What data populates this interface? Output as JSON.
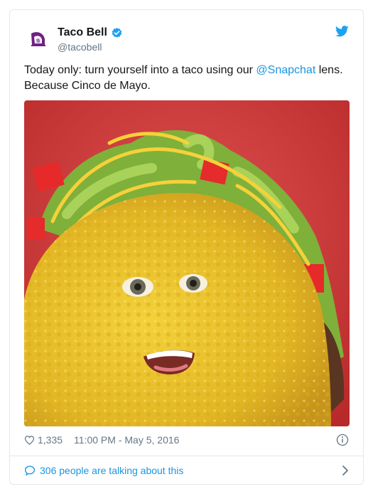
{
  "author": {
    "display_name": "Taco Bell",
    "handle": "@tacobell",
    "verified": true
  },
  "tweet": {
    "text_before": "Today only: turn yourself into a taco using our ",
    "mention": "@Snapchat",
    "text_after": " lens. Because Cinco de Mayo."
  },
  "media": {
    "description_icon": "taco-with-face-photo",
    "background_color": "#d43a3a"
  },
  "footer": {
    "like_count": "1,335",
    "timestamp": "11:00 PM - May 5, 2016"
  },
  "conversation": {
    "label": "306 people are talking about this"
  },
  "colors": {
    "link": "#1b95e0",
    "text": "#14171a",
    "muted": "#657786",
    "border": "#e1e8ed",
    "brand_purple": "#702082"
  },
  "icons": {
    "avatar": "taco-bell-logo-icon",
    "verified": "verified-badge-icon",
    "bird": "twitter-bird-icon",
    "like": "heart-icon",
    "info": "info-icon",
    "talk": "speech-bubble-icon",
    "chevron": "chevron-right-icon"
  }
}
